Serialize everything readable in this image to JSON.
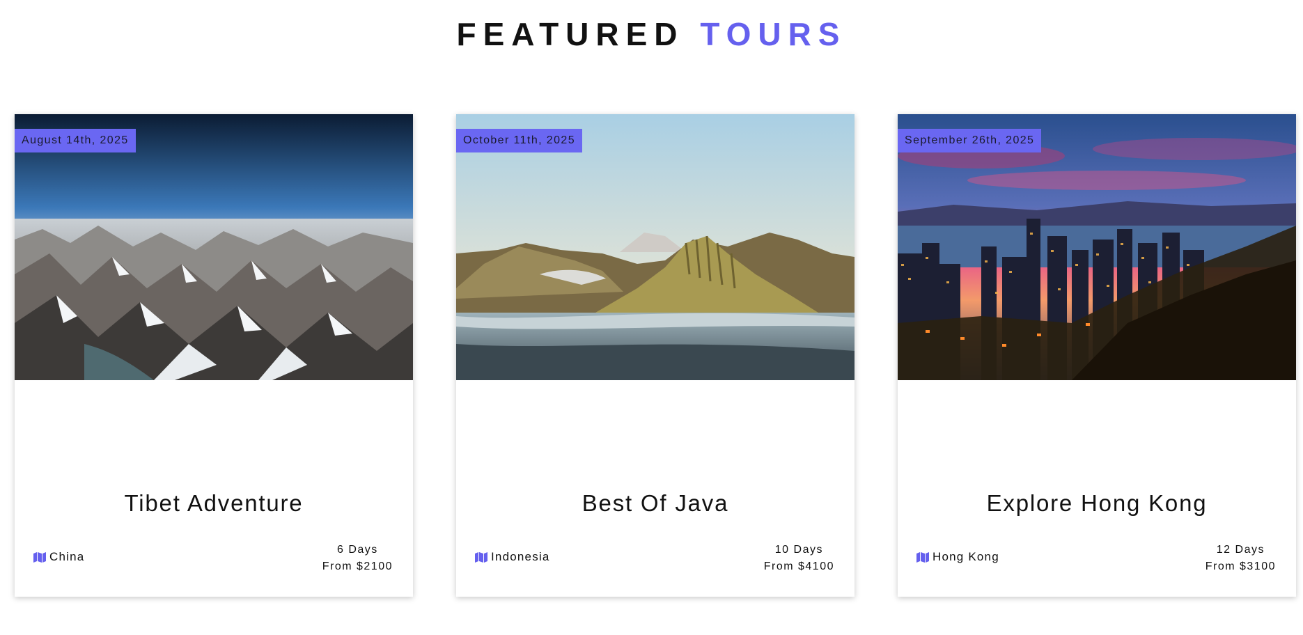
{
  "header": {
    "title_main": "FEATURED",
    "title_accent": "TOURS"
  },
  "colors": {
    "accent": "#6560ee",
    "badge": "#6a67f2"
  },
  "tours": [
    {
      "date": "August 14th, 2025",
      "name": "Tibet Adventure",
      "location": "China",
      "location_icon": "map-icon",
      "duration": "6 Days",
      "price": "From $2100"
    },
    {
      "date": "October 11th, 2025",
      "name": "Best Of Java",
      "location": "Indonesia",
      "location_icon": "map-icon",
      "duration": "10 Days",
      "price": "From $4100"
    },
    {
      "date": "September 26th, 2025",
      "name": "Explore Hong Kong",
      "location": "Hong Kong",
      "location_icon": "map-icon",
      "duration": "12 Days",
      "price": "From $3100"
    }
  ]
}
